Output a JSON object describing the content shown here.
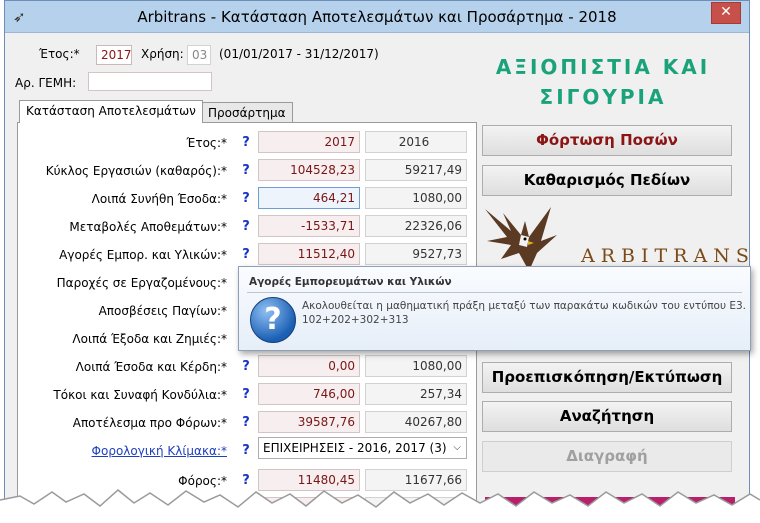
{
  "window": {
    "title": "Arbitrans - Κατάσταση Αποτελεσμάτων και Προσάρτημα - 2018",
    "close": "✕"
  },
  "header": {
    "year_label": "Έτος:*",
    "year_value": "2017",
    "fiscal_label": "Χρήση:",
    "fiscal_value": "03",
    "period": "(01/01/2017 - 31/12/2017)",
    "gemi_label": "Αρ. ΓΕΜΗ:",
    "gemi_value": ""
  },
  "slogan": {
    "line1": "ΑΞΙΟΠΙΣΤΙΑ ΚΑΙ",
    "line2": "ΣΙΓΟΥΡΙΑ",
    "color": "#1aa37a"
  },
  "logo": {
    "brand": "ARBITRANS",
    "icon": "eagle-icon"
  },
  "tabs": [
    {
      "label": "Κατάσταση Αποτελεσμάτων",
      "active": true
    },
    {
      "label": "Προσάρτημα",
      "active": false
    }
  ],
  "rows": [
    {
      "label": "Έτος:*",
      "cur": "2017",
      "prev": "2016"
    },
    {
      "label": "Κύκλος Εργασιών (καθαρός):*",
      "cur": "104528,23",
      "prev": "59217,49"
    },
    {
      "label": "Λοιπά Συνήθη Έσοδα:*",
      "cur": "464,21",
      "prev": "1080,00"
    },
    {
      "label": "Μεταβολές Αποθεμάτων:*",
      "cur": "-1533,71",
      "prev": "22326,06"
    },
    {
      "label": "Αγορές Εμπορ. και Υλικών:*",
      "cur": "11512,40",
      "prev": "9527,73"
    },
    {
      "label": "Παροχές σε Εργαζομένους:*",
      "cur": "",
      "prev": ""
    },
    {
      "label": "Αποσβέσεις Παγίων:*",
      "cur": "",
      "prev": ""
    },
    {
      "label": "Λοιπά Έξοδα και Ζημιές:*",
      "cur": "",
      "prev": ""
    },
    {
      "label": "Λοιπά Έσοδα και Κέρδη:*",
      "cur": "0,00",
      "prev": "1080,00"
    },
    {
      "label": "Τόκοι και Συναφή Κονδύλια:*",
      "cur": "746,00",
      "prev": "257,34"
    },
    {
      "label": "Αποτέλεσμα προ Φόρων:*",
      "cur": "39587,76",
      "prev": "40267,80"
    }
  ],
  "tax_scale": {
    "label": "Φορολογική Κλίμακα:*",
    "selected": "ΕΠΙΧΕΙΡΗΣΕΙΣ - 2016, 2017 (3)"
  },
  "tax": {
    "label": "Φόρος:*",
    "cur": "11480,45",
    "prev": "11677,66"
  },
  "question_mark": "?",
  "buttons": {
    "load": "Φόρτωση Ποσών",
    "clear": "Καθαρισμός Πεδίων",
    "preview": "Προεπισκόπηση/Εκτύπωση",
    "search": "Αναζήτηση",
    "delete": "Διαγραφή"
  },
  "tooltip": {
    "title": "Αγορές Εμπορευμάτων και Υλικών",
    "line1": "Ακολουθείται η μαθηματική πράξη μεταξύ των παρακάτω κωδικών του εντύπου Ε3.",
    "line2": "102+202+302+313",
    "icon": "question-icon"
  }
}
